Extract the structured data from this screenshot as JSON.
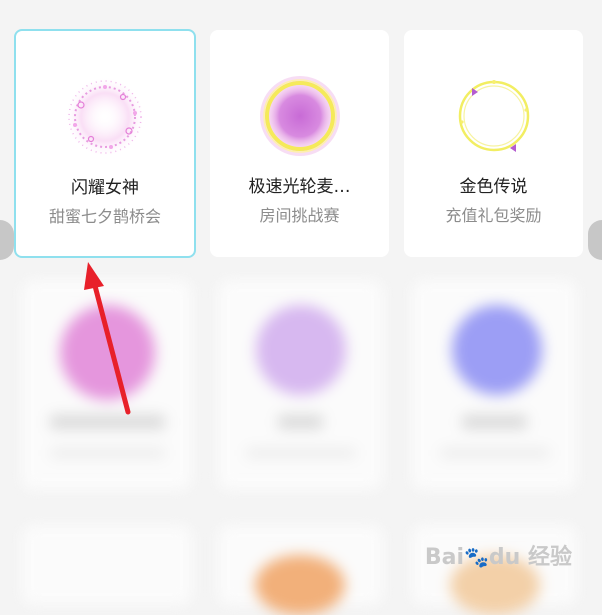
{
  "cards": [
    {
      "title": "闪耀女神",
      "subtitle": "甜蜜七夕鹊桥会",
      "selected": true,
      "icon": "sparkle-ring-icon"
    },
    {
      "title": "极速光轮麦…",
      "subtitle": "房间挑战赛",
      "selected": false,
      "icon": "glow-ring-icon"
    },
    {
      "title": "金色传说",
      "subtitle": "充值礼包奖励",
      "selected": false,
      "icon": "gold-ring-icon"
    }
  ],
  "watermark": {
    "brand": "Bai",
    "paw": "🐾",
    "suffix": "du",
    "label": "经验"
  },
  "annotation": {
    "arrow_color": "#e8202a"
  },
  "colors": {
    "selected_border": "#8fe0ee",
    "background": "#f4f4f4"
  }
}
